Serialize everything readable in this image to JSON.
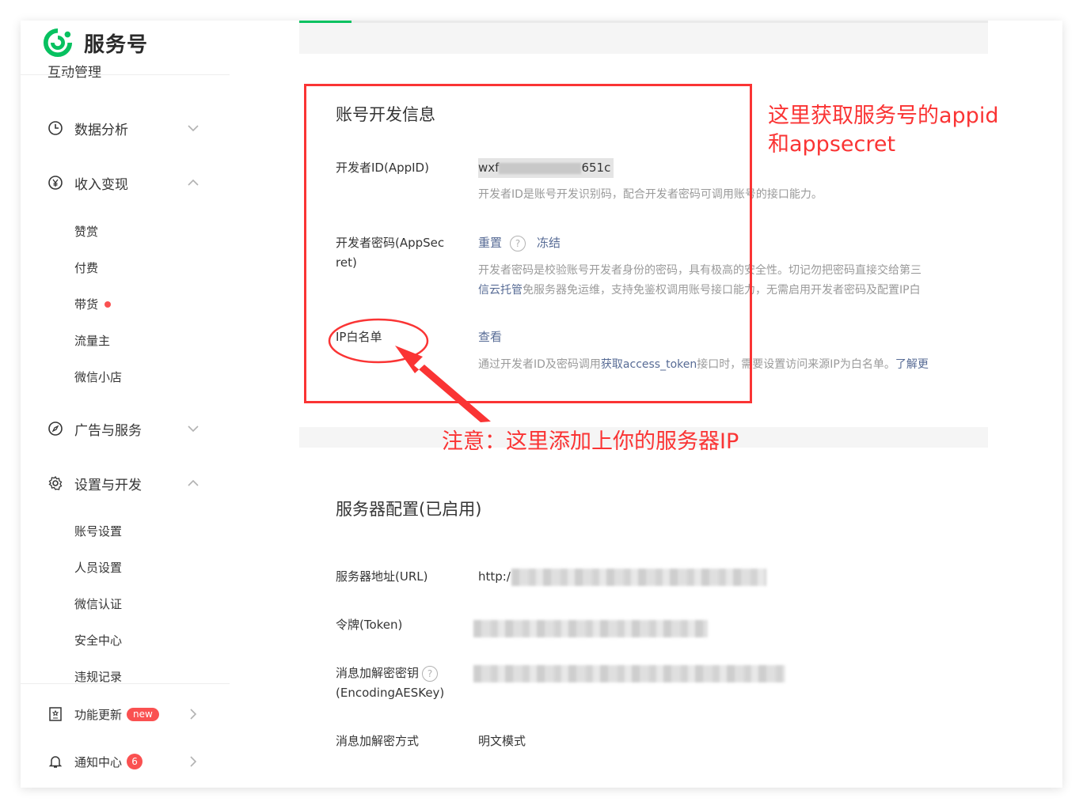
{
  "brand": {
    "name": "服务号",
    "accent": "#07c160"
  },
  "sidebar": {
    "cut_item": "互动管理",
    "groups": [
      {
        "label": "数据分析",
        "icon": "clock-icon",
        "expanded": false
      },
      {
        "label": "收入变现",
        "icon": "yen-icon",
        "expanded": true,
        "items": [
          "赞赏",
          "付费",
          "带货",
          "流量主",
          "微信小店"
        ]
      },
      {
        "label": "广告与服务",
        "icon": "compass-icon",
        "expanded": false
      },
      {
        "label": "设置与开发",
        "icon": "gear-icon",
        "expanded": true,
        "items": [
          "账号设置",
          "人员设置",
          "微信认证",
          "安全中心",
          "违规记录"
        ]
      }
    ],
    "footer": [
      {
        "label": "功能更新",
        "badge": "new",
        "icon": "update-icon"
      },
      {
        "label": "通知中心",
        "badge": "6",
        "icon": "bell-icon"
      }
    ]
  },
  "dev_info": {
    "title": "账号开发信息",
    "appid_label": "开发者ID(AppID)",
    "appid_prefix": "wxf",
    "appid_suffix": "651c",
    "appid_desc": "开发者ID是账号开发识别码，配合开发者密码可调用账号的接口能力。",
    "secret_label_1": "开发者密码(AppSec",
    "secret_label_2": "ret)",
    "reset": "重置",
    "freeze": "冻结",
    "secret_desc_1": "开发者密码是校验账号开发者身份的密码，具有极高的安全性。切记勿把密码直接交给第三",
    "secret_desc_2_link": "信云托管",
    "secret_desc_2": "免服务器免运维，支持免鉴权调用账号接口能力，无需启用开发者密码及配置IP白",
    "ip_label": "IP白名单",
    "ip_view": "查看",
    "ip_desc_1": "通过开发者ID及密码调用",
    "ip_desc_link": "获取access_token",
    "ip_desc_2": "接口时，需要设置访问来源IP为白名单。",
    "ip_desc_more": "了解更"
  },
  "server_config": {
    "title": "服务器配置(已启用)",
    "url_label": "服务器地址(URL)",
    "url_prefix": "http:/",
    "token_label": "令牌(Token)",
    "aes_label_1": "消息加解密密钥",
    "aes_label_2": "(EncodingAESKey)",
    "mode_label": "消息加解密方式",
    "mode_value": "明文模式"
  },
  "annotations": {
    "note_right_1": "这里获取服务号的appid",
    "note_right_2": "和appsecret",
    "note_bottom": "注意：这里添加上你的服务器IP",
    "color": "#fa3434"
  }
}
